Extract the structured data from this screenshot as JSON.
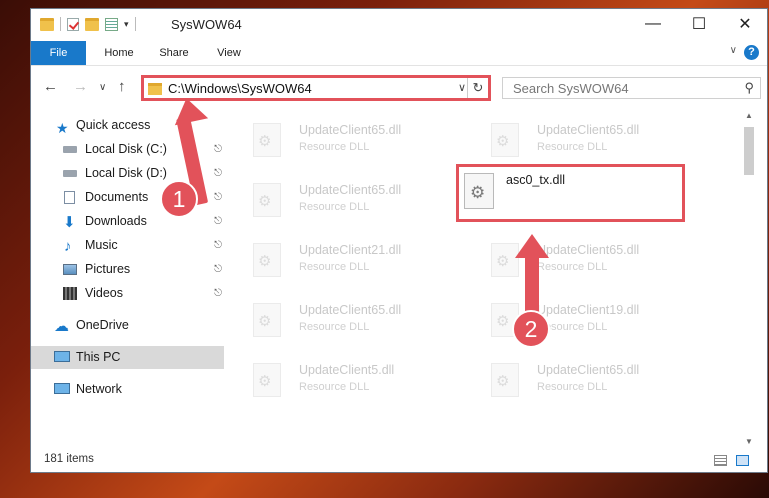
{
  "window": {
    "title": "SysWOW64"
  },
  "ribbon": {
    "tabs": [
      "File",
      "Home",
      "Share",
      "View"
    ],
    "help": "?"
  },
  "address": {
    "path": "C:\\Windows\\SysWOW64"
  },
  "search": {
    "placeholder": "Search SysWOW64"
  },
  "sidebar": {
    "items": [
      {
        "label": "Quick access",
        "icon": "star-icon"
      },
      {
        "label": "Local Disk (C:)",
        "icon": "drive-icon",
        "pinned": true
      },
      {
        "label": "Local Disk (D:)",
        "icon": "drive-icon",
        "pinned": true
      },
      {
        "label": "Documents",
        "icon": "documents-icon",
        "pinned": true
      },
      {
        "label": "Downloads",
        "icon": "downloads-icon",
        "pinned": true
      },
      {
        "label": "Music",
        "icon": "music-icon",
        "pinned": true
      },
      {
        "label": "Pictures",
        "icon": "pictures-icon",
        "pinned": true
      },
      {
        "label": "Videos",
        "icon": "videos-icon",
        "pinned": true
      },
      {
        "label": "OneDrive",
        "icon": "cloud-icon"
      },
      {
        "label": "This PC",
        "icon": "computer-icon",
        "selected": true
      },
      {
        "label": "Network",
        "icon": "network-icon"
      }
    ]
  },
  "files": [
    {
      "name": "UpdateClient65.dll",
      "desc": "Resource DLL"
    },
    {
      "name": "UpdateClient65.dll",
      "desc": "Resource DLL"
    },
    {
      "name": "UpdateClient65.dll",
      "desc": "Resource DLL"
    },
    {
      "name": "UpdateClient21.dll",
      "desc": "Resource DLL"
    },
    {
      "name": "UpdateClient65.dll",
      "desc": "Resource DLL"
    },
    {
      "name": "UpdateClient65.dll",
      "desc": "Resource DLL"
    },
    {
      "name": "UpdateClient19.dll",
      "desc": "Resource DLL"
    },
    {
      "name": "UpdateClient5.dll",
      "desc": "Resource DLL"
    },
    {
      "name": "UpdateClient65.dll",
      "desc": "Resource DLL"
    }
  ],
  "highlighted_file": {
    "name": "asc0_tx.dll"
  },
  "status": {
    "count": "181 items"
  },
  "annotations": {
    "step1": "1",
    "step2": "2",
    "color": "#e2525a"
  }
}
